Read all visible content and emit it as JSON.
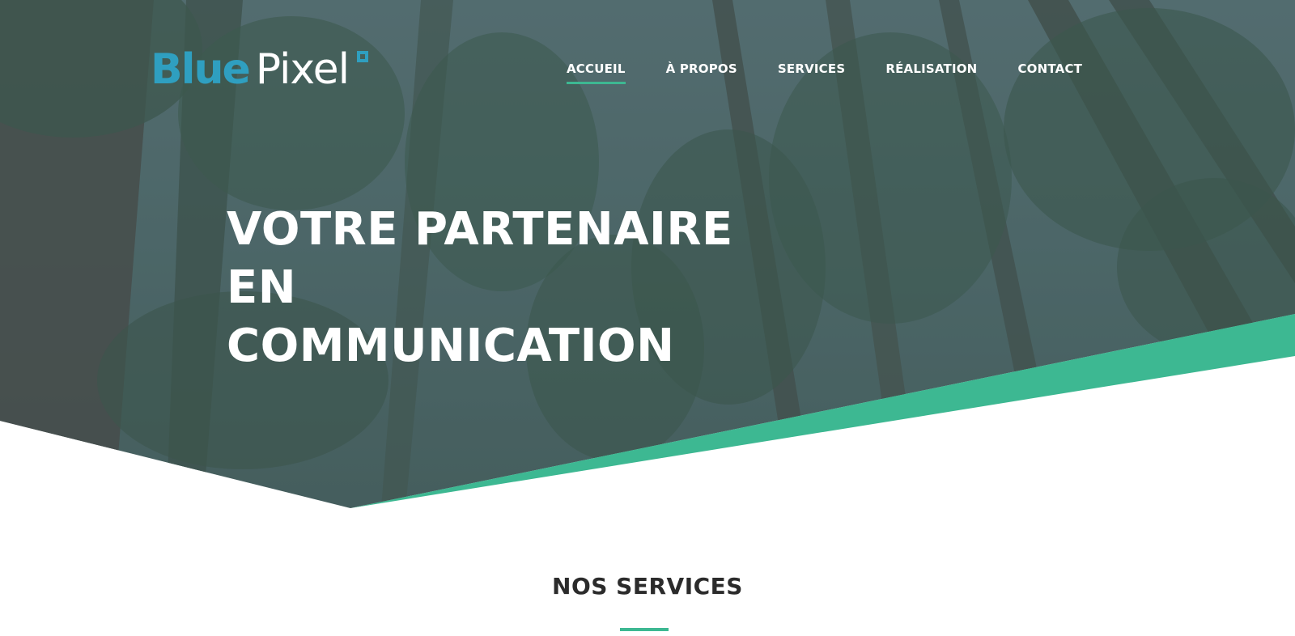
{
  "brand": {
    "name_part1": "Blue",
    "name_part2": "Pixel",
    "color_primary": "#2f9fc0",
    "color_accent": "#3db892"
  },
  "nav": {
    "items": [
      {
        "label": "ACCUEIL",
        "active": true
      },
      {
        "label": "À PROPOS",
        "active": false
      },
      {
        "label": "SERVICES",
        "active": false
      },
      {
        "label": "RÉALISATION",
        "active": false
      },
      {
        "label": "CONTACT",
        "active": false
      }
    ]
  },
  "hero": {
    "headline_lines": [
      "VOTRE PARTENAIRE",
      "EN",
      "COMMUNICATION"
    ],
    "background": "forest-canopy-photo"
  },
  "services": {
    "title": "NOS SERVICES"
  }
}
